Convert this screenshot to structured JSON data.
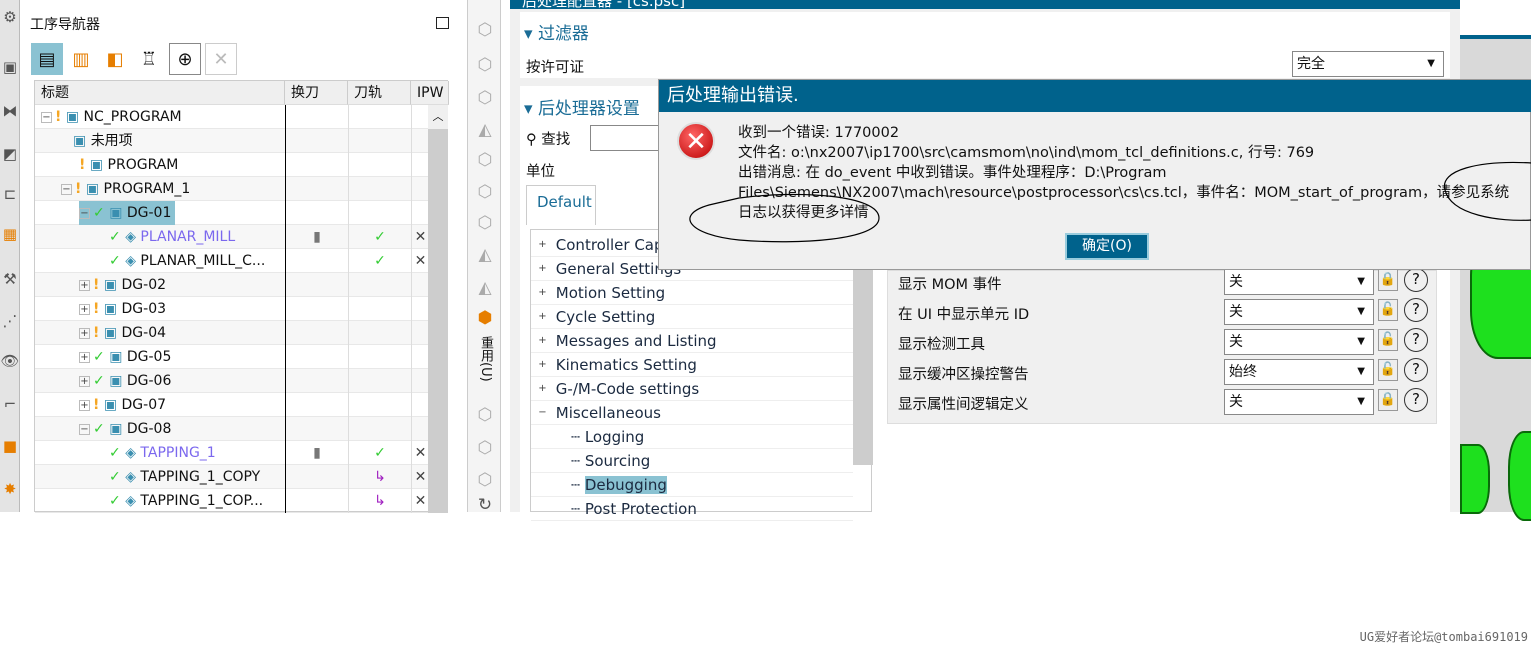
{
  "navigator": {
    "title": "工序导航器",
    "columns": [
      "标题",
      "换刀",
      "刀轨",
      "IPW"
    ],
    "rows": [
      {
        "label": "NC_PROGRAM",
        "status": "warning",
        "level": 0
      },
      {
        "label": "未用项",
        "status": "",
        "level": 1
      },
      {
        "label": "PROGRAM",
        "status": "warning",
        "level": 1
      },
      {
        "label": "PROGRAM_1",
        "status": "warning",
        "level": 1
      },
      {
        "label": "DG-01",
        "status": "ok",
        "level": 2,
        "selected": true
      },
      {
        "label": "PLANAR_MILL",
        "status": "ok",
        "level": 3,
        "tool_change": "tool",
        "path": "✓",
        "ipw": "✕"
      },
      {
        "label": "PLANAR_MILL_C...",
        "status": "ok",
        "level": 3,
        "path": "✓",
        "ipw": "✕"
      },
      {
        "label": "DG-02",
        "status": "warning",
        "level": 2
      },
      {
        "label": "DG-03",
        "status": "warning",
        "level": 2
      },
      {
        "label": "DG-04",
        "status": "warning",
        "level": 2
      },
      {
        "label": "DG-05",
        "status": "ok",
        "level": 2
      },
      {
        "label": "DG-06",
        "status": "ok",
        "level": 2
      },
      {
        "label": "DG-07",
        "status": "warning",
        "level": 2
      },
      {
        "label": "DG-08",
        "status": "ok",
        "level": 2
      },
      {
        "label": "TAPPING_1",
        "status": "ok",
        "level": 3,
        "tool_change": "tool",
        "path": "✓",
        "ipw": "✕"
      },
      {
        "label": "TAPPING_1_COPY",
        "status": "ok",
        "level": 3,
        "path": "↳",
        "ipw": "✕"
      },
      {
        "label": "TAPPING_1_COP...",
        "status": "ok",
        "level": 3,
        "path": "↳",
        "ipw": "✕"
      }
    ]
  },
  "mid_toolbar": {
    "reuse_label": "重用(U)"
  },
  "post_configurator": {
    "title": "后处理配置器 - [cs.psc]",
    "filter": {
      "header": "过滤器",
      "license_label": "按许可证",
      "license_value": "完全"
    },
    "settings": {
      "header": "后处理器设置",
      "find_label": "查找",
      "unit_label": "单位",
      "tab": "Default"
    },
    "tree": [
      {
        "label": "Controller Capabilities",
        "expander": "+"
      },
      {
        "label": "General Settings",
        "expander": "+"
      },
      {
        "label": "Motion Setting",
        "expander": "+"
      },
      {
        "label": "Cycle Setting",
        "expander": "+"
      },
      {
        "label": "Messages and Listing",
        "expander": "+"
      },
      {
        "label": "Kinematics Setting",
        "expander": "+"
      },
      {
        "label": "G-/M-Code settings",
        "expander": "+"
      },
      {
        "label": "Miscellaneous",
        "expander": "−"
      },
      {
        "label": "Logging",
        "child": true
      },
      {
        "label": "Sourcing",
        "child": true
      },
      {
        "label": "Debugging",
        "child": true,
        "selected": true
      },
      {
        "label": "Post Protection",
        "child": true
      }
    ],
    "debug_options": [
      {
        "label": "显示 MOM 事件",
        "value": "关",
        "locked": true
      },
      {
        "label": "在 UI 中显示单元 ID",
        "value": "关",
        "locked": false
      },
      {
        "label": "显示检测工具",
        "value": "关",
        "locked": false
      },
      {
        "label": "显示缓冲区操控警告",
        "value": "始终",
        "locked": false
      },
      {
        "label": "显示属性间逻辑定义",
        "value": "关",
        "locked": true
      }
    ]
  },
  "error_dialog": {
    "title": "后处理输出错误.",
    "lines": [
      "收到一个错误: 1770002",
      "文件名: o:\\nx2007\\ip1700\\src\\camsmom\\no\\ind\\mom_tcl_definitions.c, 行号: 769",
      "出错消息: 在 do_event 中收到错误。事件处理程序：D:\\Program",
      "Files\\Siemens\\NX2007\\mach\\resource\\postprocessor\\cs\\cs.tcl，事件名：MOM_start_of_program，请参见系统",
      "日志以获得更多详情"
    ],
    "ok_label": "确定(O)"
  },
  "watermark": "UG爱好者论坛@tombai691019",
  "colors": {
    "titlebar": "#00628c",
    "selection": "#8ac2d2",
    "ok": "#33cc33",
    "warning": "#f5a623"
  }
}
